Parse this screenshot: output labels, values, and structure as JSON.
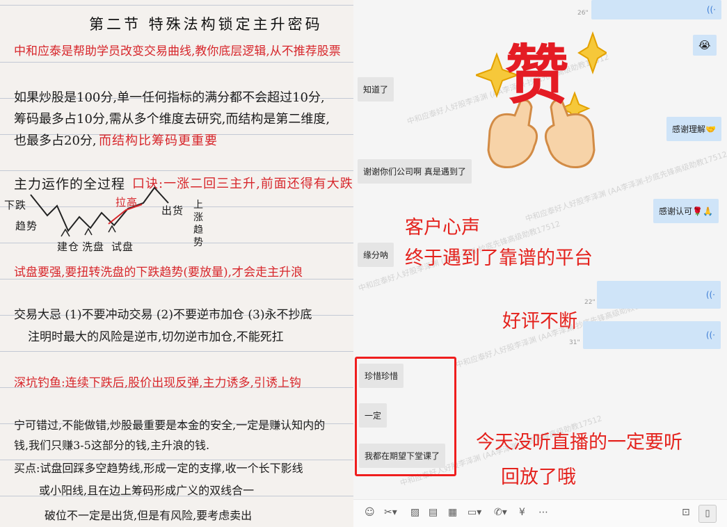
{
  "notes": {
    "title": "第二节 特殊法构锁定主升密码",
    "subtitle": "中和应泰是帮助学员改变交易曲线,教你底层逻辑,从不推荐股票",
    "para1": [
      "如果炒股是100分,单一任何指标的满分都不会超过10分,",
      "筹码最多占10分,需从多个维度去研究,而结构是第二维度,",
      "也最多占20分,"
    ],
    "para1_red": "而结构比筹码更重要",
    "mainforce_title": "主力运作的全过程",
    "mainforce_red": "口诀:一涨二回三主升,前面还得有大跌",
    "chart_labels": {
      "xia": "下跌",
      "qushi": "趋势",
      "jiancang": "建仓",
      "ximpan": "洗盘",
      "shipan": "试盘",
      "lasheng": "拉高",
      "chuhuo": "出货",
      "shang": "上",
      "zhang": "涨",
      "qu": "趋",
      "shi": "势"
    },
    "trial_red": "试盘要强,要扭转洗盘的下跌趋势(要放量),才会走主升浪",
    "trade_rules": "交易大忌 (1)不要冲动交易 (2)不要逆市加仓 (3)永不抄底",
    "note_line": "注明时最大的风险是逆市,切勿逆市加仓,不能死扛",
    "deep_pit_red": "深坑钓鱼:连续下跌后,股价出现反弹,主力诱多,引诱上钩",
    "ending": [
      "宁可错过,不能做错,炒股最重要是本金的安全,一定是赚认知内的",
      "钱,我们只赚3-5这部分的钱,主升浪的钱.",
      "买点:试盘回踩多空趋势线,形成一定的支撑,收一个长下影线",
      "或小阳线,且在边上筹码形成广义的双线合一",
      "破位不一定是出货,但是有风险,要考虑卖出"
    ]
  },
  "chat": {
    "watermark": "中和应泰好人好股李泽渊 (AA李泽渊-抄底先锋高级助教17512",
    "messages_left": [
      "知道了",
      "谢谢你们公司啊 真是遇到了",
      "缘分呐",
      "珍惜珍惜",
      "一定",
      "我都在期望下堂课了"
    ],
    "messages_right": [
      "感谢理解🤝",
      "感谢认可🌹🙏"
    ],
    "emoji_bubble": "😭",
    "voice_durations": [
      "26\"",
      "22\"",
      "31\""
    ],
    "sticker_char": "赞",
    "overlay": {
      "line1": "客户心声",
      "line2": "终于遇到了靠谱的平台",
      "line3": "好评不断",
      "line4": "今天没听直播的一定要听",
      "line5": "回放了哦"
    },
    "toolbar_icons": [
      "smile-icon",
      "scissors-icon",
      "image-icon",
      "document-icon",
      "calendar-icon",
      "folder-icon",
      "phone-icon",
      "yuan-icon",
      "more-icon"
    ],
    "toolbar_glyphs": [
      "☺",
      "✂▾",
      "▨",
      "▤",
      "▦",
      "▭▾",
      "✆▾",
      "¥",
      "⋯"
    ],
    "right_tool_glyphs": [
      "⊡",
      "▯"
    ]
  }
}
